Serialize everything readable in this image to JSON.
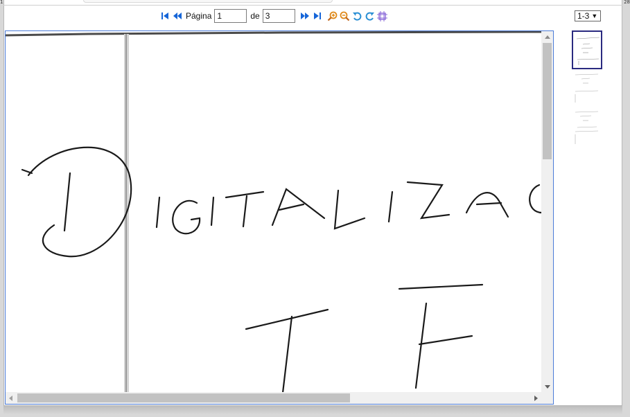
{
  "window": {
    "corner_left": "1",
    "corner_right": "28"
  },
  "toolbar": {
    "page_label": "Página",
    "current_page": "1",
    "of_label": "de",
    "total_pages": "3",
    "icons": {
      "first": "first-page-icon",
      "prev": "previous-page-icon",
      "next": "next-page-icon",
      "last": "last-page-icon",
      "zoom_in": "zoom-in-icon",
      "zoom_out": "zoom-out-icon",
      "rotate_left": "rotate-left-icon",
      "rotate_right": "rotate-right-icon",
      "fit": "fit-page-icon"
    },
    "colors": {
      "nav": "#1565d8",
      "zoom": "#e08a1a",
      "rotate": "#2a8fd4",
      "fit": "#8a6ad8"
    }
  },
  "range_select": {
    "value": "1-3"
  },
  "document": {
    "handwriting_line1": "DIGITALIZAC",
    "handwriting_line2": "TF"
  },
  "thumbnails": [
    {
      "page": 1,
      "selected": true
    },
    {
      "page": 2,
      "selected": false
    },
    {
      "page": 3,
      "selected": false
    }
  ]
}
